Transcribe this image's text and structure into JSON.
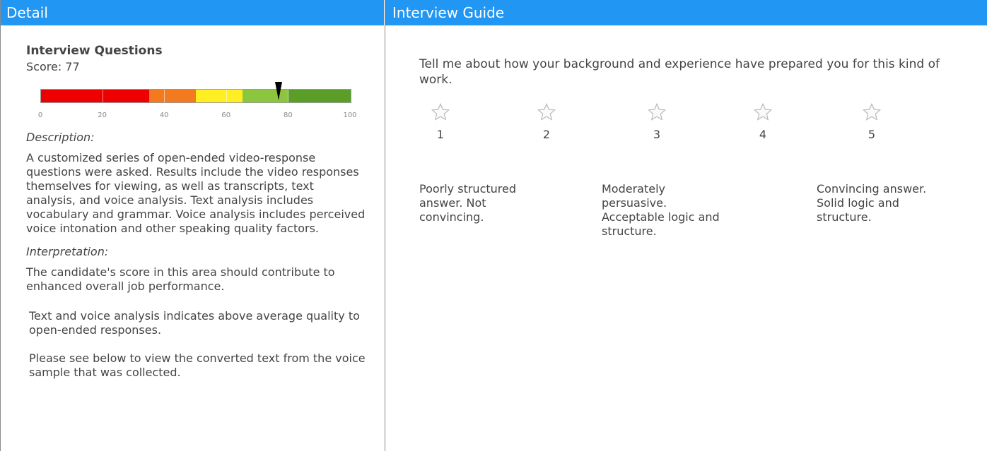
{
  "panels": {
    "left_header": "Detail",
    "right_header": "Interview Guide"
  },
  "detail": {
    "title": "Interview Questions",
    "score_text": "Score: 77",
    "score": 77,
    "scale": {
      "min": 0,
      "max": 100,
      "ticks": [
        "0",
        "20",
        "40",
        "60",
        "80",
        "100"
      ]
    },
    "segment_colors": [
      "#ee0000",
      "#ee0000",
      "#f47a20",
      "#ffee22",
      "#8cc63f",
      "#5a9e28"
    ],
    "description_label": "Description:",
    "description": "A customized series of open-ended video-response questions were asked. Results include the video responses themselves for viewing, as well as  transcripts, text analysis, and voice analysis. Text analysis includes vocabulary and grammar. Voice analysis includes perceived voice intonation and other speaking quality factors.",
    "interpretation_label": "Interpretation:",
    "interpretation": "The candidate's score in this area should contribute to enhanced overall job performance.",
    "analysis": "Text and voice analysis indicates above average quality  to open-ended responses.",
    "note": "Please see below to view the converted text from the voice sample that was collected."
  },
  "guide": {
    "question": "Tell me about how your background and experience have prepared you for this kind of work.",
    "ratings": [
      "1",
      "2",
      "3",
      "4",
      "5"
    ],
    "descriptions": [
      "Poorly structured answer. Not convincing.",
      "Moderately persuasive. Acceptable logic and structure.",
      "Convincing answer. Solid logic and structure."
    ]
  }
}
